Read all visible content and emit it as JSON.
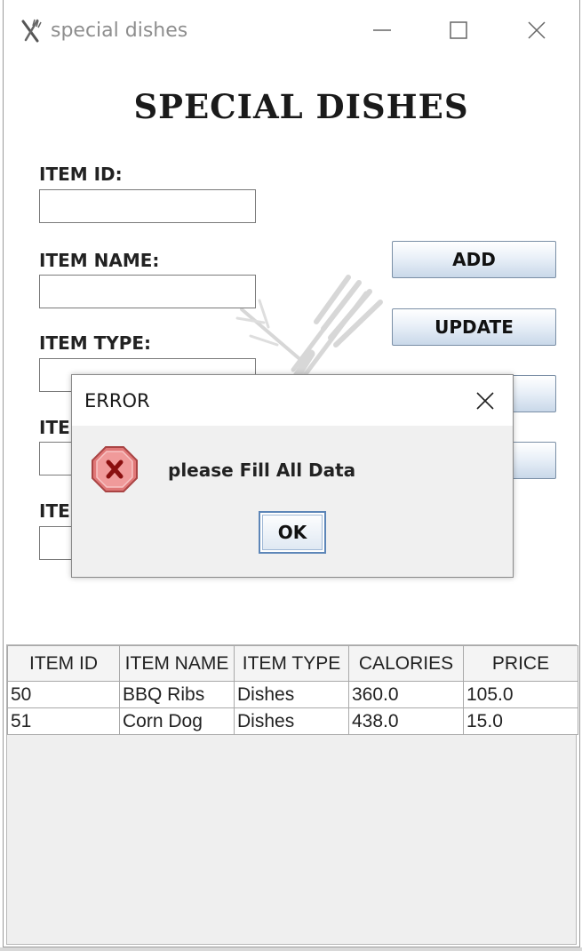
{
  "window": {
    "title": "special dishes",
    "icon": "fork-knife-icon"
  },
  "heading": "SPECIAL DISHES",
  "form": {
    "item_id_label": "ITEM ID:",
    "item_id_value": "",
    "item_name_label": "ITEM NAME:",
    "item_name_value": "",
    "item_type_label": "ITEM TYPE:",
    "item_type_value": "",
    "field4_label": "ITE",
    "field4_value": "",
    "field5_label": "ITE",
    "field5_value": ""
  },
  "buttons": {
    "add": "ADD",
    "update": "UPDATE"
  },
  "table": {
    "columns": [
      "ITEM ID",
      "ITEM NAME",
      "ITEM TYPE",
      "CALORIES",
      "PRICE"
    ],
    "rows": [
      [
        "50",
        "BBQ Ribs",
        "Dishes",
        "360.0",
        "105.0"
      ],
      [
        "51",
        "Corn Dog",
        "Dishes",
        "438.0",
        "15.0"
      ]
    ]
  },
  "dialog": {
    "title": "ERROR",
    "message": "please Fill All Data",
    "ok_label": "OK",
    "icon": "error-x-icon"
  },
  "colors": {
    "button_gradient_bottom": "#c9d8e9",
    "error_icon": "#e06666",
    "focus_border": "#5d86b8"
  }
}
